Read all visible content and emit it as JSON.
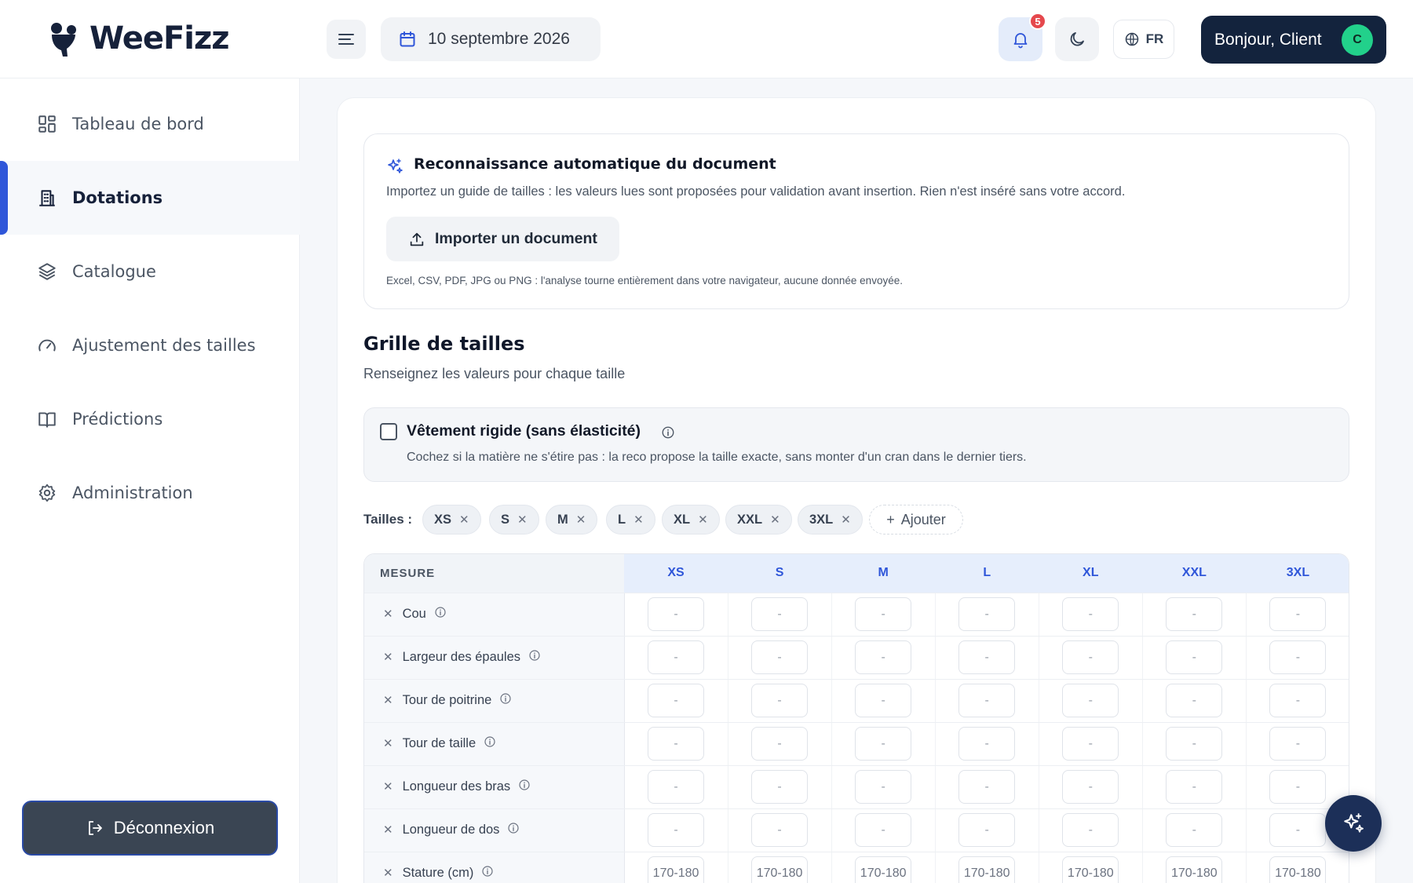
{
  "app": {
    "brand": "WeeFizz"
  },
  "header": {
    "date": "10 septembre 2026",
    "notification_count": "5",
    "language": "FR",
    "greeting": "Bonjour, Client",
    "avatar_initial": "C"
  },
  "sidebar": {
    "items": [
      {
        "label": "Tableau de bord",
        "icon": "dashboard-icon"
      },
      {
        "label": "Dotations",
        "icon": "building-icon",
        "active": true
      },
      {
        "label": "Catalogue",
        "icon": "layers-icon"
      },
      {
        "label": "Ajustement des tailles",
        "icon": "gauge-icon"
      },
      {
        "label": "Prédictions",
        "icon": "book-icon"
      },
      {
        "label": "Administration",
        "icon": "gear-icon"
      }
    ],
    "logout_label": "Déconnexion"
  },
  "ocr": {
    "title": "Reconnaissance automatique du document",
    "description": "Importez un guide de tailles : les valeurs lues sont proposées pour validation avant insertion. Rien n'est inséré sans votre accord.",
    "import_label": "Importer un document",
    "note": "Excel, CSV, PDF, JPG ou PNG : l'analyse tourne entièrement dans votre navigateur, aucune donnée envoyée."
  },
  "grid": {
    "title": "Grille de tailles",
    "subtitle": "Renseignez les valeurs pour chaque taille",
    "rigid_label": "Vêtement rigide (sans élasticité)",
    "rigid_checked": false,
    "rigid_description": "Cochez si la matière ne s'étire pas : la reco propose la taille exacte, sans monter d'un cran dans le dernier tiers.",
    "sizes_label": "Tailles :",
    "sizes": [
      "XS",
      "S",
      "M",
      "L",
      "XL",
      "XXL",
      "3XL"
    ],
    "add_label": "Ajouter",
    "measure_header": "MESURE",
    "placeholder": "-",
    "rows": [
      {
        "label": "Cou",
        "values": [
          "",
          "",
          "",
          "",
          "",
          "",
          ""
        ]
      },
      {
        "label": "Largeur des épaules",
        "values": [
          "",
          "",
          "",
          "",
          "",
          "",
          ""
        ]
      },
      {
        "label": "Tour de poitrine",
        "values": [
          "",
          "",
          "",
          "",
          "",
          "",
          ""
        ]
      },
      {
        "label": "Tour de taille",
        "values": [
          "",
          "",
          "",
          "",
          "",
          "",
          ""
        ]
      },
      {
        "label": "Longueur des bras",
        "values": [
          "",
          "",
          "",
          "",
          "",
          "",
          ""
        ]
      },
      {
        "label": "Longueur de dos",
        "values": [
          "",
          "",
          "",
          "",
          "",
          "",
          ""
        ]
      },
      {
        "label": "Stature (cm)",
        "values": [
          "170-180",
          "170-180",
          "170-180",
          "170-180",
          "170-180",
          "170-180",
          "170-180"
        ]
      }
    ]
  },
  "colors": {
    "accent": "#2f56d9",
    "brand_dark": "#13233d",
    "avatar": "#22d18b",
    "badge": "#e5484d"
  }
}
